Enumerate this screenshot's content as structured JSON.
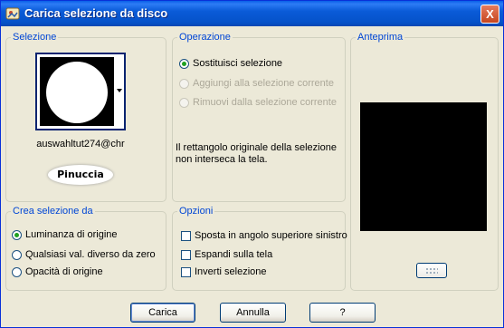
{
  "window": {
    "title": "Carica selezione da disco",
    "close_label": "X"
  },
  "selezione": {
    "title": "Selezione",
    "file_name": "auswahltut274@chr",
    "signature": "Pinuccia"
  },
  "operazione": {
    "title": "Operazione",
    "options": [
      {
        "label": "Sostituisci selezione",
        "checked": true,
        "enabled": true
      },
      {
        "label": "Aggiungi alla selezione corrente",
        "checked": false,
        "enabled": false
      },
      {
        "label": "Rimuovi dalla selezione corrente",
        "checked": false,
        "enabled": false
      }
    ],
    "info": "Il rettangolo originale della selezione non interseca la tela."
  },
  "anteprima": {
    "title": "Anteprima"
  },
  "crea": {
    "title": "Crea selezione da",
    "options": [
      {
        "label": "Luminanza di origine",
        "checked": true
      },
      {
        "label": "Qualsiasi val. diverso da zero",
        "checked": false
      },
      {
        "label": "Opacità di origine",
        "checked": false
      }
    ]
  },
  "opzioni": {
    "title": "Opzioni",
    "options": [
      {
        "label": "Sposta in angolo superiore sinistro",
        "checked": false
      },
      {
        "label": "Espandi sulla tela",
        "checked": false
      },
      {
        "label": "Inverti selezione",
        "checked": false
      }
    ]
  },
  "buttons": {
    "carica": "Carica",
    "annulla": "Annulla",
    "help": "?"
  },
  "colors": {
    "titlebar": "#0a5bd8",
    "group_title": "#0046d5",
    "dialog_bg": "#ece9d8",
    "radio_dot": "#21a121"
  }
}
